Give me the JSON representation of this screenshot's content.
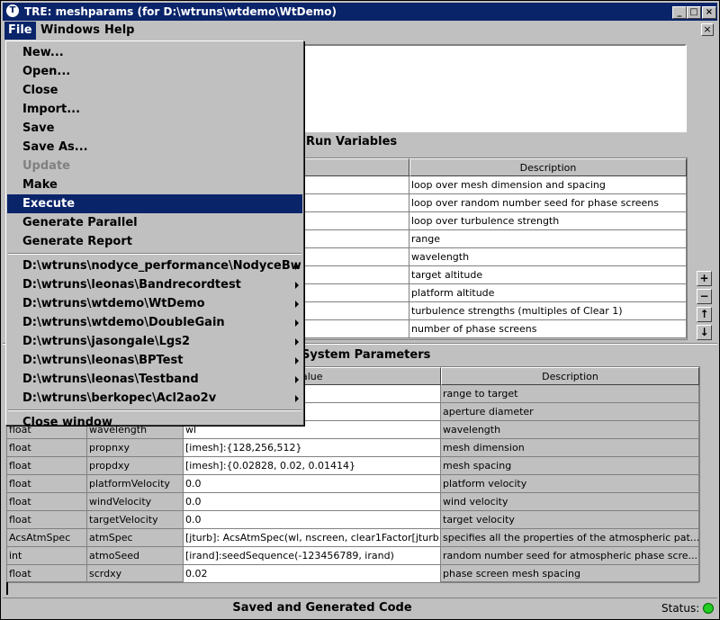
{
  "window": {
    "title": "TRE:  meshparams (for D:\\wtruns\\wtdemo\\WtDemo)",
    "app_icon": "T",
    "minimize": "_",
    "maximize": "□",
    "close": "×",
    "inner_close": "×"
  },
  "menubar": {
    "file": "File",
    "windows": "Windows",
    "help": "Help"
  },
  "file_menu": {
    "items": [
      "New...",
      "Open...",
      "Close",
      "Import...",
      "Save",
      "Save As...",
      "Update",
      "Make",
      "Execute",
      "Generate Parallel",
      "Generate Report"
    ],
    "recent": [
      "D:\\wtruns\\nodyce_performance\\NodyceBw",
      "D:\\wtruns\\leonas\\Bandrecordtest",
      "D:\\wtruns\\wtdemo\\WtDemo",
      "D:\\wtruns\\wtdemo\\DoubleGain",
      "D:\\wtruns\\jasongale\\Lgs2",
      "D:\\wtruns\\leonas\\BPTest",
      "D:\\wtruns\\leonas\\Testband",
      "D:\\wtruns\\berkopec\\Acl2ao2v"
    ],
    "close_window": "Close window",
    "highlighted": "Execute",
    "disabled": "Update"
  },
  "run_variables": {
    "title": "Run Variables",
    "header_description": "Description",
    "descriptions": [
      "loop over mesh dimension and spacing",
      "loop over random number seed for phase screens",
      "loop over turbulence strength",
      "range",
      "wavelength",
      "target altitude",
      "platform altitude",
      "turbulence strengths (multiples of Clear 1)",
      "number of phase screens"
    ],
    "buttons": {
      "add": "+",
      "remove": "−",
      "up": "↑",
      "down": "↓"
    }
  },
  "system_parameters": {
    "title": "System Parameters",
    "headers": {
      "value": "alue",
      "description": "Description"
    },
    "rows": [
      {
        "type": "",
        "name": "",
        "value": "",
        "description": "range to target"
      },
      {
        "type": "",
        "name": "",
        "value": "",
        "description": "aperture diameter"
      },
      {
        "type": "float",
        "name": "wavelength",
        "value": "wl",
        "description": "wavelength"
      },
      {
        "type": "float",
        "name": "propnxy",
        "value": "[imesh]:{128,256,512}",
        "description": "mesh dimension"
      },
      {
        "type": "float",
        "name": "propdxy",
        "value": "[imesh]:{0.02828, 0.02, 0.01414}",
        "description": "mesh spacing"
      },
      {
        "type": "float",
        "name": "platformVelocity",
        "value": "0.0",
        "description": "platform velocity"
      },
      {
        "type": "float",
        "name": "windVelocity",
        "value": "0.0",
        "description": "wind velocity"
      },
      {
        "type": "float",
        "name": "targetVelocity",
        "value": "0.0",
        "description": "target velocity"
      },
      {
        "type": "AcsAtmSpec",
        "name": "atmSpec",
        "value": "[jturb]: AcsAtmSpec(wl, nscreen, clear1Factor[jturb...",
        "description": "specifies all the properties of  the atmospheric pat..."
      },
      {
        "type": "int",
        "name": "atmoSeed",
        "value": "[irand]:seedSequence(-123456789, irand)",
        "description": "random number seed for atmospheric phase scre..."
      },
      {
        "type": "float",
        "name": "scrdxy",
        "value": "0.02",
        "description": "phase screen mesh spacing"
      }
    ]
  },
  "statusbar": {
    "message": "Saved and Generated Code",
    "label": "Status:",
    "led_color": "#22cc22"
  }
}
